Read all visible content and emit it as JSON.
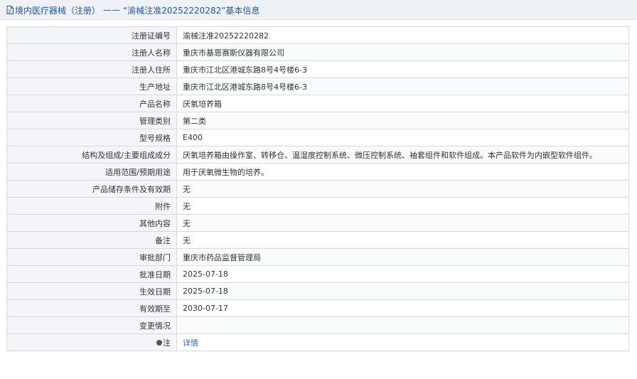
{
  "header": {
    "category": "境内医疗器械（注册）",
    "separator": "——",
    "title": "“渝械注准20252220282”基本信息"
  },
  "rows": [
    {
      "label": "注册证编号",
      "value": "渝械注准20252220282"
    },
    {
      "label": "注册人名称",
      "value": "重庆市基恩赛斯仪器有限公司"
    },
    {
      "label": "注册人住所",
      "value": "重庆市江北区港城东路8号4号楼6-3"
    },
    {
      "label": "生产地址",
      "value": "重庆市江北区港城东路8号4号楼6-3"
    },
    {
      "label": "产品名称",
      "value": "厌氧培养箱"
    },
    {
      "label": "管理类别",
      "value": "第二类"
    },
    {
      "label": "型号规格",
      "value": "E400"
    },
    {
      "label": "结构及组成/主要组成成分",
      "value": "厌氧培养箱由操作室、转移仓、温湿度控制系统、微压控制系统、袖套组件和软件组成。本产品软件为内嵌型软件组件。"
    },
    {
      "label": "适用范围/预期用途",
      "value": "用于厌氧微生物的培养。"
    },
    {
      "label": "产品储存条件及有效期",
      "value": "无"
    },
    {
      "label": "附件",
      "value": "无"
    },
    {
      "label": "其他内容",
      "value": "无"
    },
    {
      "label": "备注",
      "value": "无"
    },
    {
      "label": "审批部门",
      "value": "重庆市药品监督管理局"
    },
    {
      "label": "批准日期",
      "value": "2025-07-18"
    },
    {
      "label": "生效日期",
      "value": "2025-07-18"
    },
    {
      "label": "有效期至",
      "value": "2030-07-17"
    },
    {
      "label": "变更情况",
      "value": ""
    }
  ],
  "note_row": {
    "label": "注",
    "icon": "note-dot-icon",
    "link_text": "详情"
  },
  "colors": {
    "link": "#1e5aa8",
    "label_bg": "#f3f5f8",
    "border": "#d6dbe1",
    "header_bg": "#eef1f5"
  }
}
